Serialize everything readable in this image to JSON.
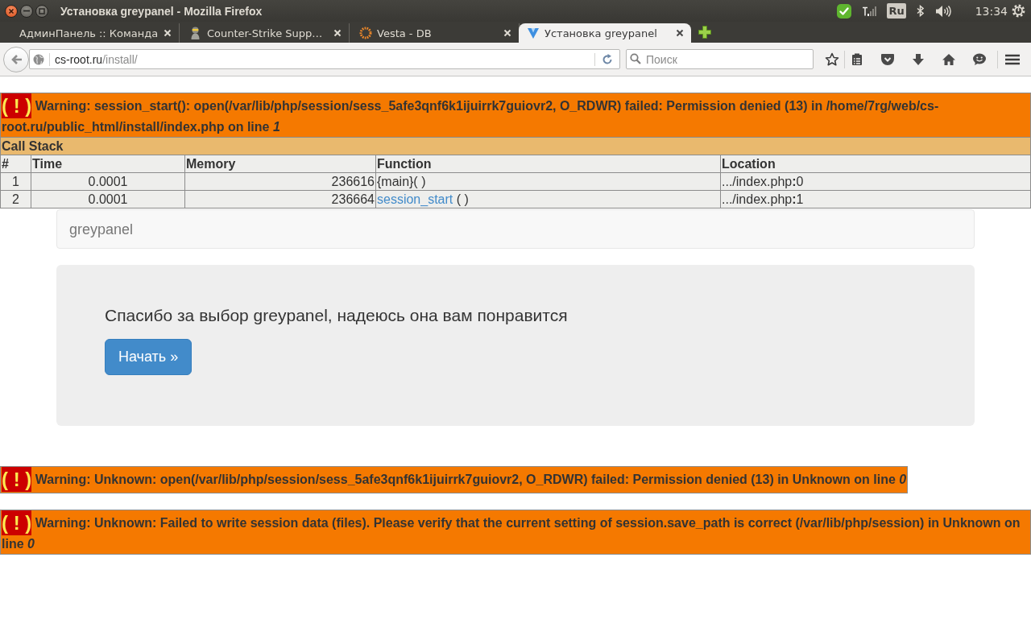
{
  "window": {
    "title": "Установка greypanel - Mozilla Firefox"
  },
  "system_tray": {
    "keyboard_layout": "Ru",
    "clock": "13:34"
  },
  "tabs": [
    {
      "label": "АдминПанель :: Команда",
      "kind": "plain",
      "selected": false
    },
    {
      "label": "Counter-Strike Supp…",
      "kind": "figure",
      "selected": false
    },
    {
      "label": "Vesta - DB",
      "kind": "ring",
      "selected": false
    },
    {
      "label": "Установка greypanel",
      "kind": "triangle",
      "selected": true
    }
  ],
  "address_bar": {
    "host": "cs-root.ru",
    "path": "/install/"
  },
  "search": {
    "placeholder": "Поиск"
  },
  "page": [
    {
      "kind": "warning",
      "symbol": "( ! )",
      "message": "Warning: session_start(): open(/var/lib/php/session/sess_5afe3qnf6k1ijuirrk7guiovr2, O_RDWR) failed: Permission denied (13) in /home/7rg/web/cs-root.ru/public_html/install/index.php on line *1*",
      "call_stack": {
        "title": "Call Stack",
        "columns": [
          "#",
          "Time",
          "Memory",
          "Function",
          "Location"
        ],
        "rows": [
          {
            "number": "1",
            "time": "0.0001",
            "memory": "236616",
            "function": {
              "name": "{main}",
              "args": "( )",
              "linked": false
            },
            "location": ".../index.php**:**0"
          },
          {
            "number": "2",
            "time": "0.0001",
            "memory": "236664",
            "function": {
              "name": "session_start",
              "args": "( )",
              "linked": true
            },
            "location": ".../index.php**:**1"
          }
        ]
      }
    },
    {
      "kind": "navbar",
      "brand": "greypanel"
    },
    {
      "kind": "jumbotron",
      "text": "Спасибо за выбор greypanel, надеюсь она вам понравится",
      "button": "Начать »"
    },
    {
      "kind": "warning",
      "symbol": "( ! )",
      "message": "Warning: Unknown: open(/var/lib/php/session/sess_5afe3qnf6k1ijuirrk7guiovr2, O_RDWR) failed: Permission denied (13) in Unknown on line *0*"
    },
    {
      "kind": "warning",
      "symbol": "( ! )",
      "message": "Warning: Unknown: Failed to write session data (files). Please verify that the current setting of session.save_path is correct (/var/lib/php/session) in Unknown on line *0*"
    }
  ]
}
